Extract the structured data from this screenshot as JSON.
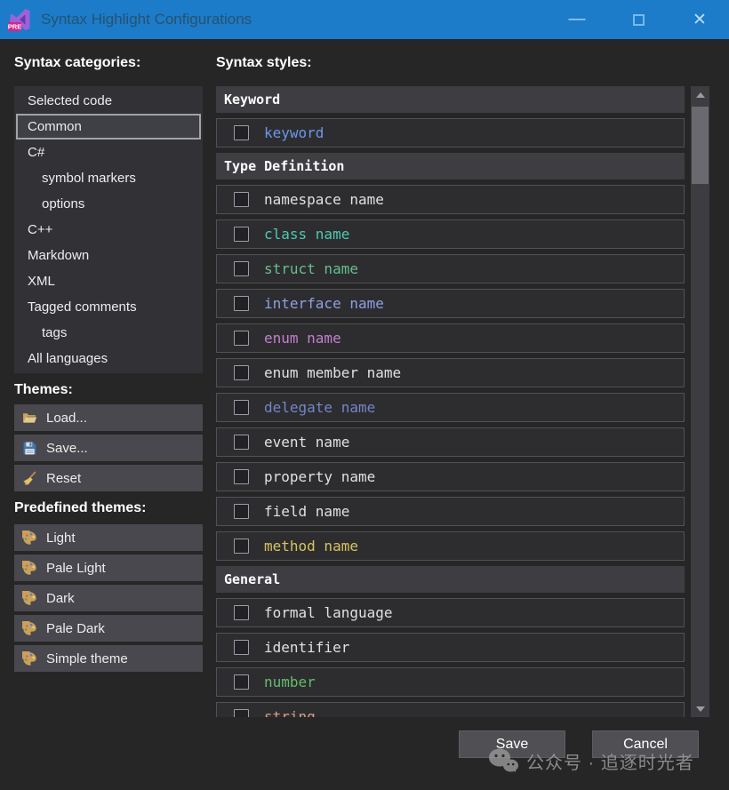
{
  "window": {
    "title": "Syntax Highlight Configurations",
    "badge": "PRE",
    "controls": {
      "minimize": "—",
      "close": "✕"
    }
  },
  "left": {
    "categories_label": "Syntax categories:",
    "categories": [
      {
        "label": "Selected code",
        "indent": 0,
        "selected": false
      },
      {
        "label": "Common",
        "indent": 0,
        "selected": true
      },
      {
        "label": "C#",
        "indent": 0,
        "selected": false
      },
      {
        "label": "symbol markers",
        "indent": 1,
        "selected": false
      },
      {
        "label": "options",
        "indent": 1,
        "selected": false
      },
      {
        "label": "C++",
        "indent": 0,
        "selected": false
      },
      {
        "label": "Markdown",
        "indent": 0,
        "selected": false
      },
      {
        "label": "XML",
        "indent": 0,
        "selected": false
      },
      {
        "label": "Tagged comments",
        "indent": 0,
        "selected": false
      },
      {
        "label": "tags",
        "indent": 1,
        "selected": false
      },
      {
        "label": "All languages",
        "indent": 0,
        "selected": false
      }
    ],
    "themes_label": "Themes:",
    "theme_buttons": [
      {
        "label": "Load...",
        "icon": "folder-open-icon"
      },
      {
        "label": "Save...",
        "icon": "save-disk-icon"
      },
      {
        "label": "Reset",
        "icon": "reset-broom-icon"
      }
    ],
    "predefined_label": "Predefined themes:",
    "predefined_buttons": [
      {
        "label": "Light",
        "icon": "palette-icon"
      },
      {
        "label": "Pale Light",
        "icon": "palette-icon"
      },
      {
        "label": "Dark",
        "icon": "palette-icon"
      },
      {
        "label": "Pale Dark",
        "icon": "palette-icon"
      },
      {
        "label": "Simple theme",
        "icon": "palette-icon"
      }
    ]
  },
  "right": {
    "styles_label": "Syntax styles:",
    "sections": [
      {
        "header": "Keyword",
        "rows": [
          {
            "label": "keyword",
            "color": "#6e96e8",
            "checked": false
          }
        ]
      },
      {
        "header": "Type Definition",
        "rows": [
          {
            "label": "namespace name",
            "color": "#e0e0e0",
            "checked": false
          },
          {
            "label": "class name",
            "color": "#4ec9b0",
            "checked": false
          },
          {
            "label": "struct name",
            "color": "#66be8e",
            "checked": false
          },
          {
            "label": "interface name",
            "color": "#8f9fe6",
            "checked": false
          },
          {
            "label": "enum name",
            "color": "#c37fce",
            "checked": false
          },
          {
            "label": "enum member name",
            "color": "#e0e0e0",
            "checked": false
          },
          {
            "label": "delegate name",
            "color": "#7585c6",
            "checked": false
          },
          {
            "label": "event name",
            "color": "#e0e0e0",
            "checked": false
          },
          {
            "label": "property name",
            "color": "#e0e0e0",
            "checked": false
          },
          {
            "label": "field name",
            "color": "#e0e0e0",
            "checked": false
          },
          {
            "label": "method name",
            "color": "#d9c35f",
            "checked": false
          }
        ]
      },
      {
        "header": "General",
        "rows": [
          {
            "label": "formal language",
            "color": "#e0e0e0",
            "checked": false
          },
          {
            "label": "identifier",
            "color": "#e0e0e0",
            "checked": false
          },
          {
            "label": "number",
            "color": "#62bd6a",
            "checked": false
          },
          {
            "label": "string",
            "color": "#d69d85",
            "checked": false
          }
        ]
      }
    ]
  },
  "footer": {
    "save_label": "Save",
    "cancel_label": "Cancel"
  },
  "watermark": {
    "text": "公众号 · 追逐时光者"
  }
}
